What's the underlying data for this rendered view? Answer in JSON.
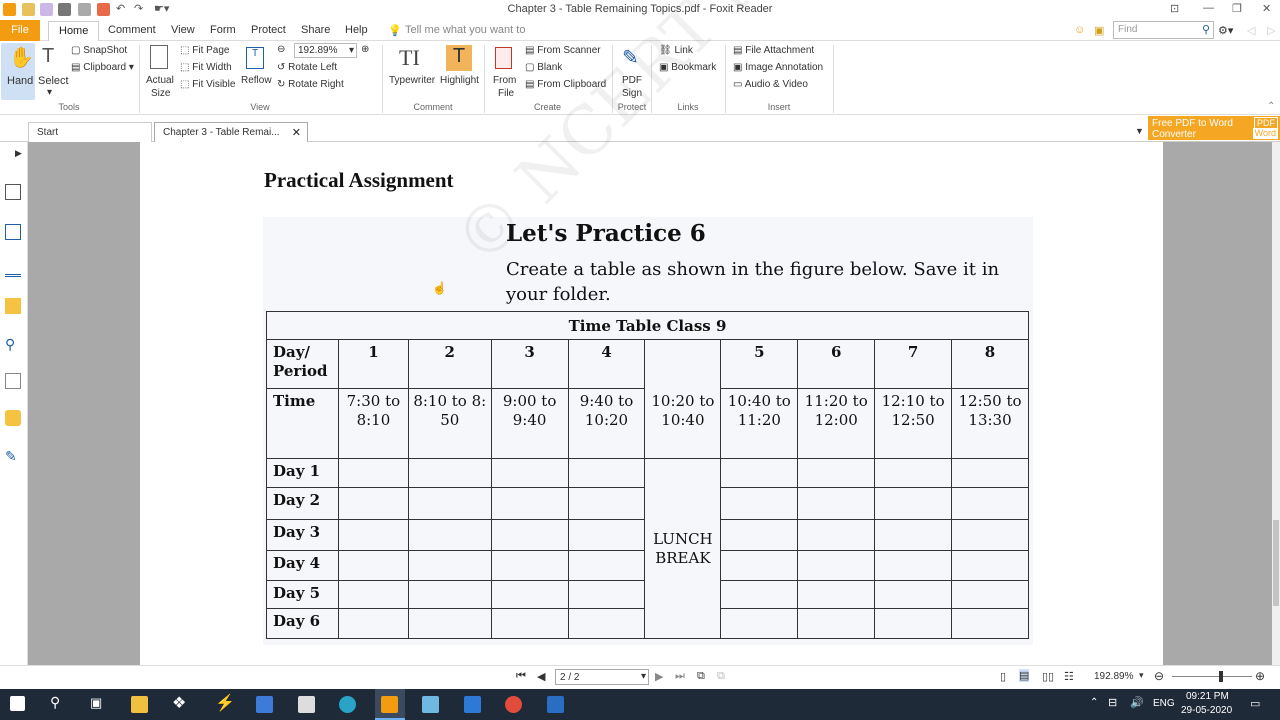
{
  "window": {
    "title": "Chapter 3 - Table Remaining Topics.pdf - Foxit Reader"
  },
  "menu": {
    "tabs": [
      "File",
      "Home",
      "Comment",
      "View",
      "Form",
      "Protect",
      "Share",
      "Help"
    ],
    "tell_me_placeholder": "Tell me what you want to",
    "find_placeholder": "Find"
  },
  "ribbon": {
    "hand": "Hand",
    "select": "Select",
    "snapshot": "SnapShot",
    "clipboard": "Clipboard",
    "actual_size_1": "Actual",
    "actual_size_2": "Size",
    "fit_page": "Fit Page",
    "fit_width": "Fit Width",
    "fit_visible": "Fit Visible",
    "reflow": "Reflow",
    "zoom_value": "192.89%",
    "rotate_left": "Rotate Left",
    "rotate_right": "Rotate Right",
    "typewriter": "Typewriter",
    "highlight": "Highlight",
    "from_file_1": "From",
    "from_file_2": "File",
    "from_scanner": "From Scanner",
    "blank": "Blank",
    "from_clipboard": "From Clipboard",
    "pdf_sign_1": "PDF",
    "pdf_sign_2": "Sign",
    "link": "Link",
    "bookmark": "Bookmark",
    "file_attachment": "File Attachment",
    "image_annotation": "Image Annotation",
    "audio_video": "Audio & Video",
    "groups": {
      "tools": "Tools",
      "view": "View",
      "comment": "Comment",
      "create": "Create",
      "protect": "Protect",
      "links": "Links",
      "insert": "Insert"
    }
  },
  "ad": {
    "line1": "Free PDF to Word",
    "line2": "Converter",
    "badge1": "PDF",
    "badge2": "Word"
  },
  "doc_tabs": {
    "start": "Start",
    "current": "Chapter 3 - Table Remai..."
  },
  "document": {
    "heading": "Practical Assignment",
    "practice_title": "Let's Practice 6",
    "instruction_1": "Create a table as shown in the figure below. Save it in",
    "instruction_2": "your folder.",
    "watermark": "© NCERT not to be republished",
    "table": {
      "title": "Time Table Class 9",
      "day_period": "Day/ Period",
      "periods": [
        "1",
        "2",
        "3",
        "4",
        "5",
        "6",
        "7",
        "8"
      ],
      "time_label": "Time",
      "times": [
        "7:30 to 8:10",
        "8:10 to 8: 50",
        "9:00 to 9:40",
        "9:40 to 10:20",
        "10:20 to 10:40",
        "10:40 to 11:20",
        "11:20 to 12:00",
        "12:10 to 12:50",
        "12:50 to 13:30"
      ],
      "days": [
        "Day 1",
        "Day 2",
        "Day 3",
        "Day 4",
        "Day 5",
        "Day 6"
      ],
      "lunch": "LUNCH BREAK"
    }
  },
  "nav": {
    "page": "2 / 2",
    "zoom": "192.89%"
  },
  "taskbar": {
    "lang": "ENG",
    "time": "09:21 PM",
    "date": "29-05-2020"
  }
}
